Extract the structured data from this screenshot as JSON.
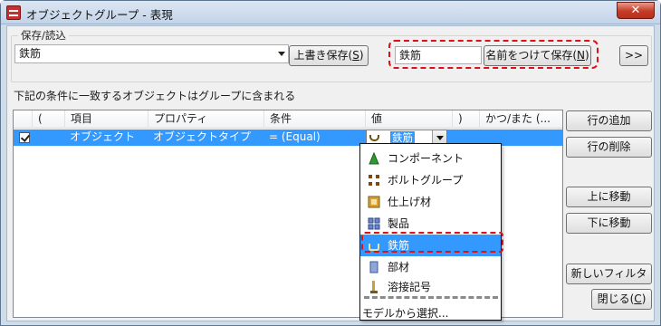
{
  "window": {
    "title": "オブジェクトグループ - 表現",
    "close_glyph": "✕"
  },
  "save_group": {
    "label": "保存/読込",
    "selected_preset": "鉄筋",
    "overwrite_label": "上書き保存(",
    "overwrite_key": "S",
    "name_value": "鉄筋",
    "save_as_label": "名前をつけて保存(",
    "save_as_key": "N",
    "expand_label": ">>"
  },
  "condition_text": "下記の条件に一致するオブジェクトはグループに含まれる",
  "grid": {
    "columns": [
      "(",
      "項目",
      "プロパティ",
      "条件",
      "値",
      ")",
      "かつ/また (..."
    ],
    "row": {
      "checked": true,
      "item": "オブジェクト",
      "property": "オブジェクトタイプ",
      "condition": "= (Equal)",
      "value": "鉄筋"
    }
  },
  "dropdown": {
    "items": [
      {
        "label": "コンポーネント",
        "icon": "component-icon"
      },
      {
        "label": "ボルトグループ",
        "icon": "bolt-group-icon"
      },
      {
        "label": "仕上げ材",
        "icon": "finish-material-icon"
      },
      {
        "label": "製品",
        "icon": "product-icon"
      },
      {
        "label": "鉄筋",
        "icon": "rebar-icon",
        "selected": true
      },
      {
        "label": "部材",
        "icon": "part-icon"
      },
      {
        "label": "溶接記号",
        "icon": "weld-icon"
      }
    ],
    "more": "モデルから選択..."
  },
  "side_buttons": {
    "add_row": "行の追加",
    "delete_row": "行の削除",
    "move_up": "上に移動",
    "move_down": "下に移動",
    "new_filter": "新しいフィルター",
    "close_label": "閉じる(",
    "close_key": "C"
  },
  "colors": {
    "selection": "#3399ff",
    "highlight": "#e0101a",
    "window_frame": "#cfdcea"
  }
}
